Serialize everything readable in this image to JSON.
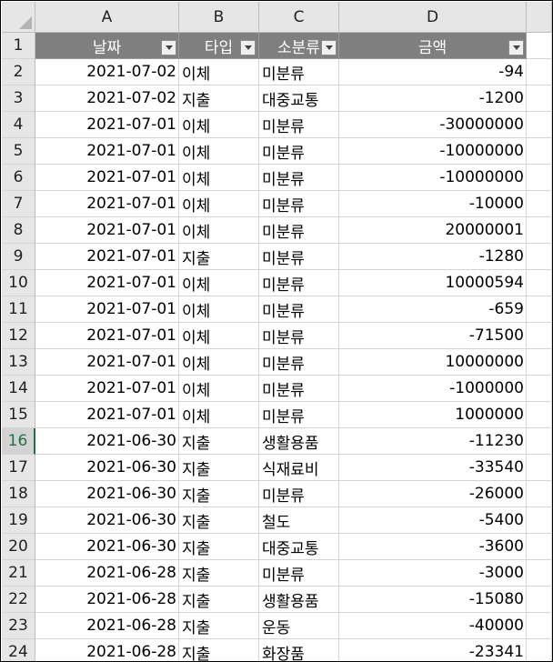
{
  "columns": [
    "A",
    "B",
    "C",
    "D"
  ],
  "header": {
    "date": "날짜",
    "type": "타입",
    "category": "소분류",
    "amount": "금액"
  },
  "row_numbers": [
    "1",
    "2",
    "3",
    "4",
    "5",
    "6",
    "7",
    "8",
    "9",
    "10",
    "11",
    "12",
    "13",
    "14",
    "15",
    "16",
    "17",
    "18",
    "19",
    "20",
    "21",
    "22",
    "23",
    "24"
  ],
  "selected_row": "16",
  "rows": [
    {
      "date": "2021-07-02",
      "type": "이체",
      "category": "미분류",
      "amount": "-94"
    },
    {
      "date": "2021-07-02",
      "type": "지출",
      "category": "대중교통",
      "amount": "-1200"
    },
    {
      "date": "2021-07-01",
      "type": "이체",
      "category": "미분류",
      "amount": "-30000000"
    },
    {
      "date": "2021-07-01",
      "type": "이체",
      "category": "미분류",
      "amount": "-10000000"
    },
    {
      "date": "2021-07-01",
      "type": "이체",
      "category": "미분류",
      "amount": "-10000000"
    },
    {
      "date": "2021-07-01",
      "type": "이체",
      "category": "미분류",
      "amount": "-10000"
    },
    {
      "date": "2021-07-01",
      "type": "이체",
      "category": "미분류",
      "amount": "20000001"
    },
    {
      "date": "2021-07-01",
      "type": "지출",
      "category": "미분류",
      "amount": "-1280"
    },
    {
      "date": "2021-07-01",
      "type": "이체",
      "category": "미분류",
      "amount": "10000594"
    },
    {
      "date": "2021-07-01",
      "type": "이체",
      "category": "미분류",
      "amount": "-659"
    },
    {
      "date": "2021-07-01",
      "type": "이체",
      "category": "미분류",
      "amount": "-71500"
    },
    {
      "date": "2021-07-01",
      "type": "이체",
      "category": "미분류",
      "amount": "10000000"
    },
    {
      "date": "2021-07-01",
      "type": "이체",
      "category": "미분류",
      "amount": "-1000000"
    },
    {
      "date": "2021-07-01",
      "type": "이체",
      "category": "미분류",
      "amount": "1000000"
    },
    {
      "date": "2021-06-30",
      "type": "지출",
      "category": "생활용품",
      "amount": "-11230"
    },
    {
      "date": "2021-06-30",
      "type": "지출",
      "category": "식재료비",
      "amount": "-33540"
    },
    {
      "date": "2021-06-30",
      "type": "지출",
      "category": "미분류",
      "amount": "-26000"
    },
    {
      "date": "2021-06-30",
      "type": "지출",
      "category": "철도",
      "amount": "-5400"
    },
    {
      "date": "2021-06-30",
      "type": "지출",
      "category": "대중교통",
      "amount": "-3600"
    },
    {
      "date": "2021-06-28",
      "type": "지출",
      "category": "미분류",
      "amount": "-3000"
    },
    {
      "date": "2021-06-28",
      "type": "지출",
      "category": "생활용품",
      "amount": "-15080"
    },
    {
      "date": "2021-06-28",
      "type": "지출",
      "category": "운동",
      "amount": "-40000"
    },
    {
      "date": "2021-06-28",
      "type": "지출",
      "category": "화장품",
      "amount": "-23341"
    }
  ],
  "colors": {
    "header_bg": "#7f7f7f",
    "header_text": "#ffffff",
    "selection": "#217346"
  }
}
